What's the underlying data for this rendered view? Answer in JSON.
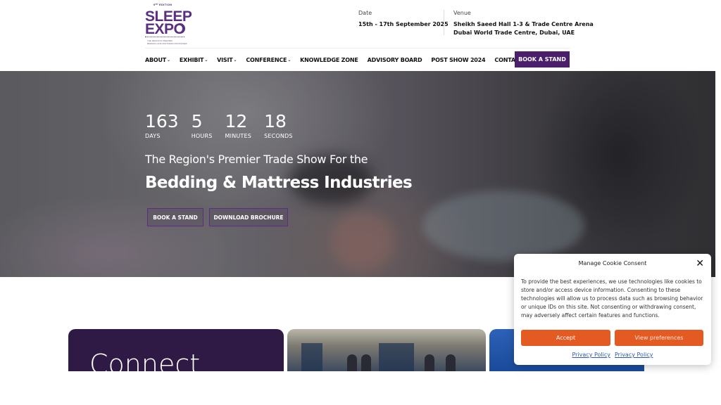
{
  "logo": {
    "edition": "9ᵀᴴ EDITION",
    "line1": "SLEEP",
    "line2": "EXPO",
    "tagline1": "THE REGION'S PREMIER",
    "tagline2": "BEDDING AND MATTRESS INDUSTRIES"
  },
  "event": {
    "date_label": "Date",
    "date_value": "15th - 17th September 2025",
    "venue_label": "Venue",
    "venue_line1": "Sheikh Saeed Hall 1-3 & Trade Centre Arena",
    "venue_line2": "Dubai World Trade Centre, Dubai, UAE"
  },
  "nav": {
    "items": [
      {
        "label": "ABOUT",
        "dropdown": true
      },
      {
        "label": "EXHIBIT",
        "dropdown": true
      },
      {
        "label": "VISIT",
        "dropdown": true
      },
      {
        "label": "CONFERENCE",
        "dropdown": true
      },
      {
        "label": "KNOWLEDGE ZONE",
        "dropdown": false
      },
      {
        "label": "ADVISORY BOARD",
        "dropdown": false
      },
      {
        "label": "POST SHOW 2024",
        "dropdown": false
      },
      {
        "label": "CONTACT US",
        "dropdown": false
      }
    ],
    "chevron": "⌄",
    "cta": "BOOK A STAND"
  },
  "hero": {
    "countdown": [
      {
        "value": "163",
        "label": "DAYS"
      },
      {
        "value": "5",
        "label": "HOURS"
      },
      {
        "value": "12",
        "label": "MINUTES"
      },
      {
        "value": "18",
        "label": "SECONDS"
      }
    ],
    "subtitle": "The Region's Premier Trade Show For the",
    "title": "Bedding & Mattress Industries",
    "button_primary": "BOOK A STAND",
    "button_secondary": "DOWNLOAD BROCHURE"
  },
  "cards": {
    "card1_text": "Connect"
  },
  "cookie": {
    "title": "Manage Cookie Consent",
    "close": "✕",
    "body": "To provide the best experiences, we use technologies like cookies to store and/or access device information. Consenting to these technologies will allow us to process data such as browsing behavior or unique IDs on this site. Not consenting or withdrawing consent, may adversely affect certain features and functions.",
    "accept": "Accept",
    "preferences": "View preferences",
    "link1": "Privacy Policy",
    "link2": "Privacy Policy"
  },
  "colors": {
    "brand_purple": "#4a1f6b",
    "cookie_orange": "#e35a22",
    "link_blue": "#2a5aa8"
  }
}
